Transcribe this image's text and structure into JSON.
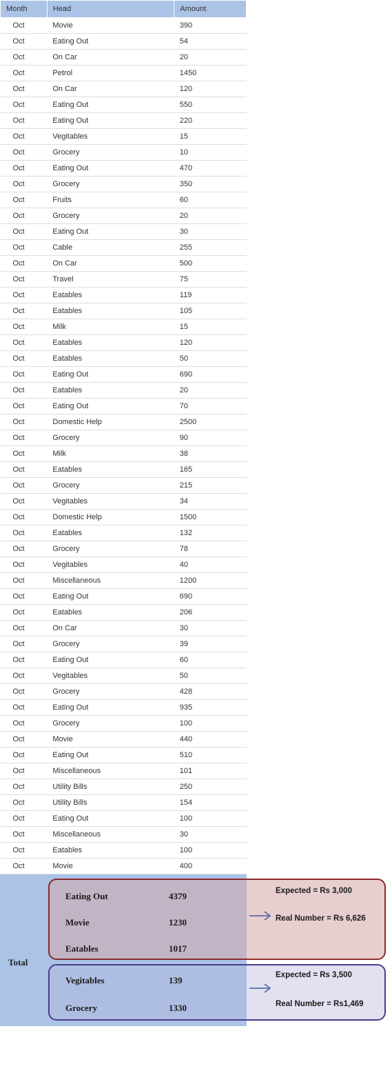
{
  "columns": {
    "month": "Month",
    "head": "Head",
    "amount": "Amount"
  },
  "rows": [
    {
      "month": "Oct",
      "head": "Movie",
      "amount": "390"
    },
    {
      "month": "Oct",
      "head": "Eating Out",
      "amount": "54"
    },
    {
      "month": "Oct",
      "head": "On Car",
      "amount": "20"
    },
    {
      "month": "Oct",
      "head": "Petrol",
      "amount": "1450"
    },
    {
      "month": "Oct",
      "head": "On Car",
      "amount": "120"
    },
    {
      "month": "Oct",
      "head": "Eating Out",
      "amount": "550"
    },
    {
      "month": "Oct",
      "head": "Eating Out",
      "amount": "220"
    },
    {
      "month": "Oct",
      "head": "Vegitables",
      "amount": "15"
    },
    {
      "month": "Oct",
      "head": "Grocery",
      "amount": "10"
    },
    {
      "month": "Oct",
      "head": "Eating Out",
      "amount": "470"
    },
    {
      "month": "Oct",
      "head": "Grocery",
      "amount": "350"
    },
    {
      "month": "Oct",
      "head": "Fruits",
      "amount": "60"
    },
    {
      "month": "Oct",
      "head": "Grocery",
      "amount": "20"
    },
    {
      "month": "Oct",
      "head": "Eating Out",
      "amount": "30"
    },
    {
      "month": "Oct",
      "head": "Cable",
      "amount": "255"
    },
    {
      "month": "Oct",
      "head": "On Car",
      "amount": "500"
    },
    {
      "month": "Oct",
      "head": "Travel",
      "amount": "75"
    },
    {
      "month": "Oct",
      "head": "Eatables",
      "amount": "119"
    },
    {
      "month": "Oct",
      "head": "Eatables",
      "amount": "105"
    },
    {
      "month": "Oct",
      "head": "Milk",
      "amount": "15"
    },
    {
      "month": "Oct",
      "head": "Eatables",
      "amount": "120"
    },
    {
      "month": "Oct",
      "head": "Eatables",
      "amount": "50"
    },
    {
      "month": "Oct",
      "head": "Eating Out",
      "amount": "690"
    },
    {
      "month": "Oct",
      "head": "Eatables",
      "amount": "20"
    },
    {
      "month": "Oct",
      "head": "Eating Out",
      "amount": "70"
    },
    {
      "month": "Oct",
      "head": "Domestic Help",
      "amount": "2500"
    },
    {
      "month": "Oct",
      "head": "Grocery",
      "amount": "90"
    },
    {
      "month": "Oct",
      "head": "Milk",
      "amount": "38"
    },
    {
      "month": "Oct",
      "head": "Eatables",
      "amount": "165"
    },
    {
      "month": "Oct",
      "head": "Grocery",
      "amount": "215"
    },
    {
      "month": "Oct",
      "head": "Vegitables",
      "amount": "34"
    },
    {
      "month": "Oct",
      "head": "Domestic Help",
      "amount": "1500"
    },
    {
      "month": "Oct",
      "head": "Eatables",
      "amount": "132"
    },
    {
      "month": "Oct",
      "head": "Grocery",
      "amount": "78"
    },
    {
      "month": "Oct",
      "head": "Vegitables",
      "amount": "40"
    },
    {
      "month": "Oct",
      "head": "Miscellaneous",
      "amount": "1200"
    },
    {
      "month": "Oct",
      "head": "Eating Out",
      "amount": "690"
    },
    {
      "month": "Oct",
      "head": "Eatables",
      "amount": "206"
    },
    {
      "month": "Oct",
      "head": "On Car",
      "amount": "30"
    },
    {
      "month": "Oct",
      "head": "Grocery",
      "amount": "39"
    },
    {
      "month": "Oct",
      "head": "Eating Out",
      "amount": "60"
    },
    {
      "month": "Oct",
      "head": "Vegitables",
      "amount": "50"
    },
    {
      "month": "Oct",
      "head": "Grocery",
      "amount": "428"
    },
    {
      "month": "Oct",
      "head": "Eating Out",
      "amount": "935"
    },
    {
      "month": "Oct",
      "head": "Grocery",
      "amount": "100"
    },
    {
      "month": "Oct",
      "head": "Movie",
      "amount": "440"
    },
    {
      "month": "Oct",
      "head": "Eating Out",
      "amount": "510"
    },
    {
      "month": "Oct",
      "head": "Miscellaneous",
      "amount": "101"
    },
    {
      "month": "Oct",
      "head": "Utility Bills",
      "amount": "250"
    },
    {
      "month": "Oct",
      "head": "Utility Bills",
      "amount": "154"
    },
    {
      "month": "Oct",
      "head": "Eating Out",
      "amount": "100"
    },
    {
      "month": "Oct",
      "head": "Miscellaneous",
      "amount": "30"
    },
    {
      "month": "Oct",
      "head": "Eatables",
      "amount": "100"
    },
    {
      "month": "Oct",
      "head": "Movie",
      "amount": "400"
    }
  ],
  "summary": {
    "total_label": "Total",
    "group1": [
      {
        "category": "Eating Out",
        "value": "4379"
      },
      {
        "category": "Movie",
        "value": "1230"
      },
      {
        "category": "Eatables",
        "value": "1017"
      }
    ],
    "group1_notes": {
      "expected": "Expected = Rs 3,000",
      "real": "Real Number = Rs 6,626"
    },
    "group2": [
      {
        "category": "Vegitables",
        "value": "139"
      },
      {
        "category": "Grocery",
        "value": "1330"
      }
    ],
    "group2_notes": {
      "expected": "Expected = Rs 3,500",
      "real": "Real Number = Rs1,469"
    }
  }
}
